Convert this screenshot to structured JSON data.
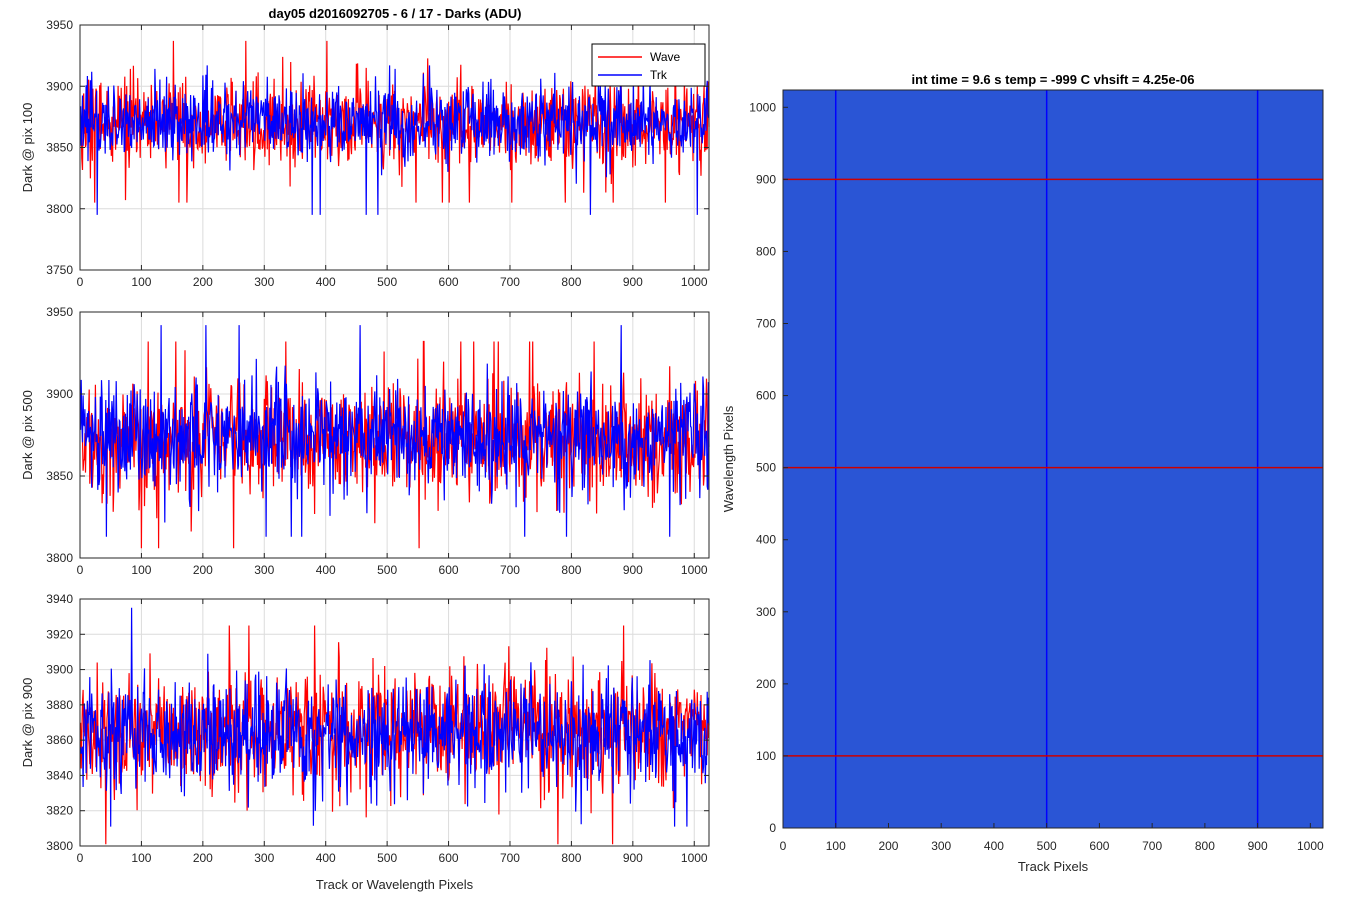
{
  "figure": {
    "title": "day05 d2016092705 - 6 / 17 - Darks (ADU)",
    "image_title": "int time = 9.6 s   temp = -999 C   vhsift = 4.25e-06"
  },
  "legend": {
    "placement": "top-right of first panel",
    "entries": [
      {
        "label": "Wave",
        "color": "#ff0000"
      },
      {
        "label": "Trk",
        "color": "#0000ff"
      }
    ]
  },
  "chart_data": [
    {
      "type": "line",
      "ylabel": "Dark @ pix 100",
      "xlabel": "",
      "xlim": [
        0,
        1024
      ],
      "ylim": [
        3750,
        3950
      ],
      "xticks": [
        0,
        100,
        200,
        300,
        400,
        500,
        600,
        700,
        800,
        900,
        1000
      ],
      "yticks": [
        3750,
        3800,
        3850,
        3900,
        3950
      ],
      "grid": true,
      "series": [
        {
          "name": "Wave",
          "color": "#ff0000",
          "mean": 3870,
          "spread": 18,
          "min": 3805,
          "max": 3937
        },
        {
          "name": "Trk",
          "color": "#0000ff",
          "mean": 3871,
          "spread": 16,
          "min": 3795,
          "max": 3917
        }
      ]
    },
    {
      "type": "line",
      "ylabel": "Dark @ pix 500",
      "xlabel": "",
      "xlim": [
        0,
        1024
      ],
      "ylim": [
        3800,
        3950
      ],
      "xticks": [
        0,
        100,
        200,
        300,
        400,
        500,
        600,
        700,
        800,
        900,
        1000
      ],
      "yticks": [
        3800,
        3850,
        3900,
        3950
      ],
      "grid": true,
      "series": [
        {
          "name": "Wave",
          "color": "#ff0000",
          "mean": 3872,
          "spread": 18,
          "min": 3806,
          "max": 3932
        },
        {
          "name": "Trk",
          "color": "#0000ff",
          "mean": 3873,
          "spread": 17,
          "min": 3813,
          "max": 3942
        }
      ]
    },
    {
      "type": "line",
      "ylabel": "Dark @ pix 900",
      "xlabel": "Track or Wavelength Pixels",
      "xlim": [
        0,
        1024
      ],
      "ylim": [
        3800,
        3940
      ],
      "xticks": [
        0,
        100,
        200,
        300,
        400,
        500,
        600,
        700,
        800,
        900,
        1000
      ],
      "yticks": [
        3800,
        3820,
        3840,
        3860,
        3880,
        3900,
        3920,
        3940
      ],
      "grid": true,
      "series": [
        {
          "name": "Wave",
          "color": "#ff0000",
          "mean": 3866,
          "spread": 17,
          "min": 3801,
          "max": 3925
        },
        {
          "name": "Trk",
          "color": "#0000ff",
          "mean": 3864,
          "spread": 16,
          "min": 3811,
          "max": 3935
        }
      ]
    },
    {
      "type": "heatmap",
      "title": "int time = 9.6 s   temp = -999 C   vhsift = 4.25e-06",
      "xlabel": "Track Pixels",
      "ylabel": "Wavelength Pixels",
      "xlim": [
        0,
        1024
      ],
      "ylim": [
        0,
        1024
      ],
      "xticks": [
        0,
        100,
        200,
        300,
        400,
        500,
        600,
        700,
        800,
        900,
        1000
      ],
      "yticks": [
        0,
        100,
        200,
        300,
        400,
        500,
        600,
        700,
        800,
        900,
        1000
      ],
      "background_color": "#2a55d5",
      "vertical_markers": {
        "color": "#0000ff",
        "x": [
          100,
          500,
          900
        ]
      },
      "horizontal_markers": {
        "color": "#cc0000",
        "y": [
          100,
          500,
          900
        ]
      }
    }
  ]
}
